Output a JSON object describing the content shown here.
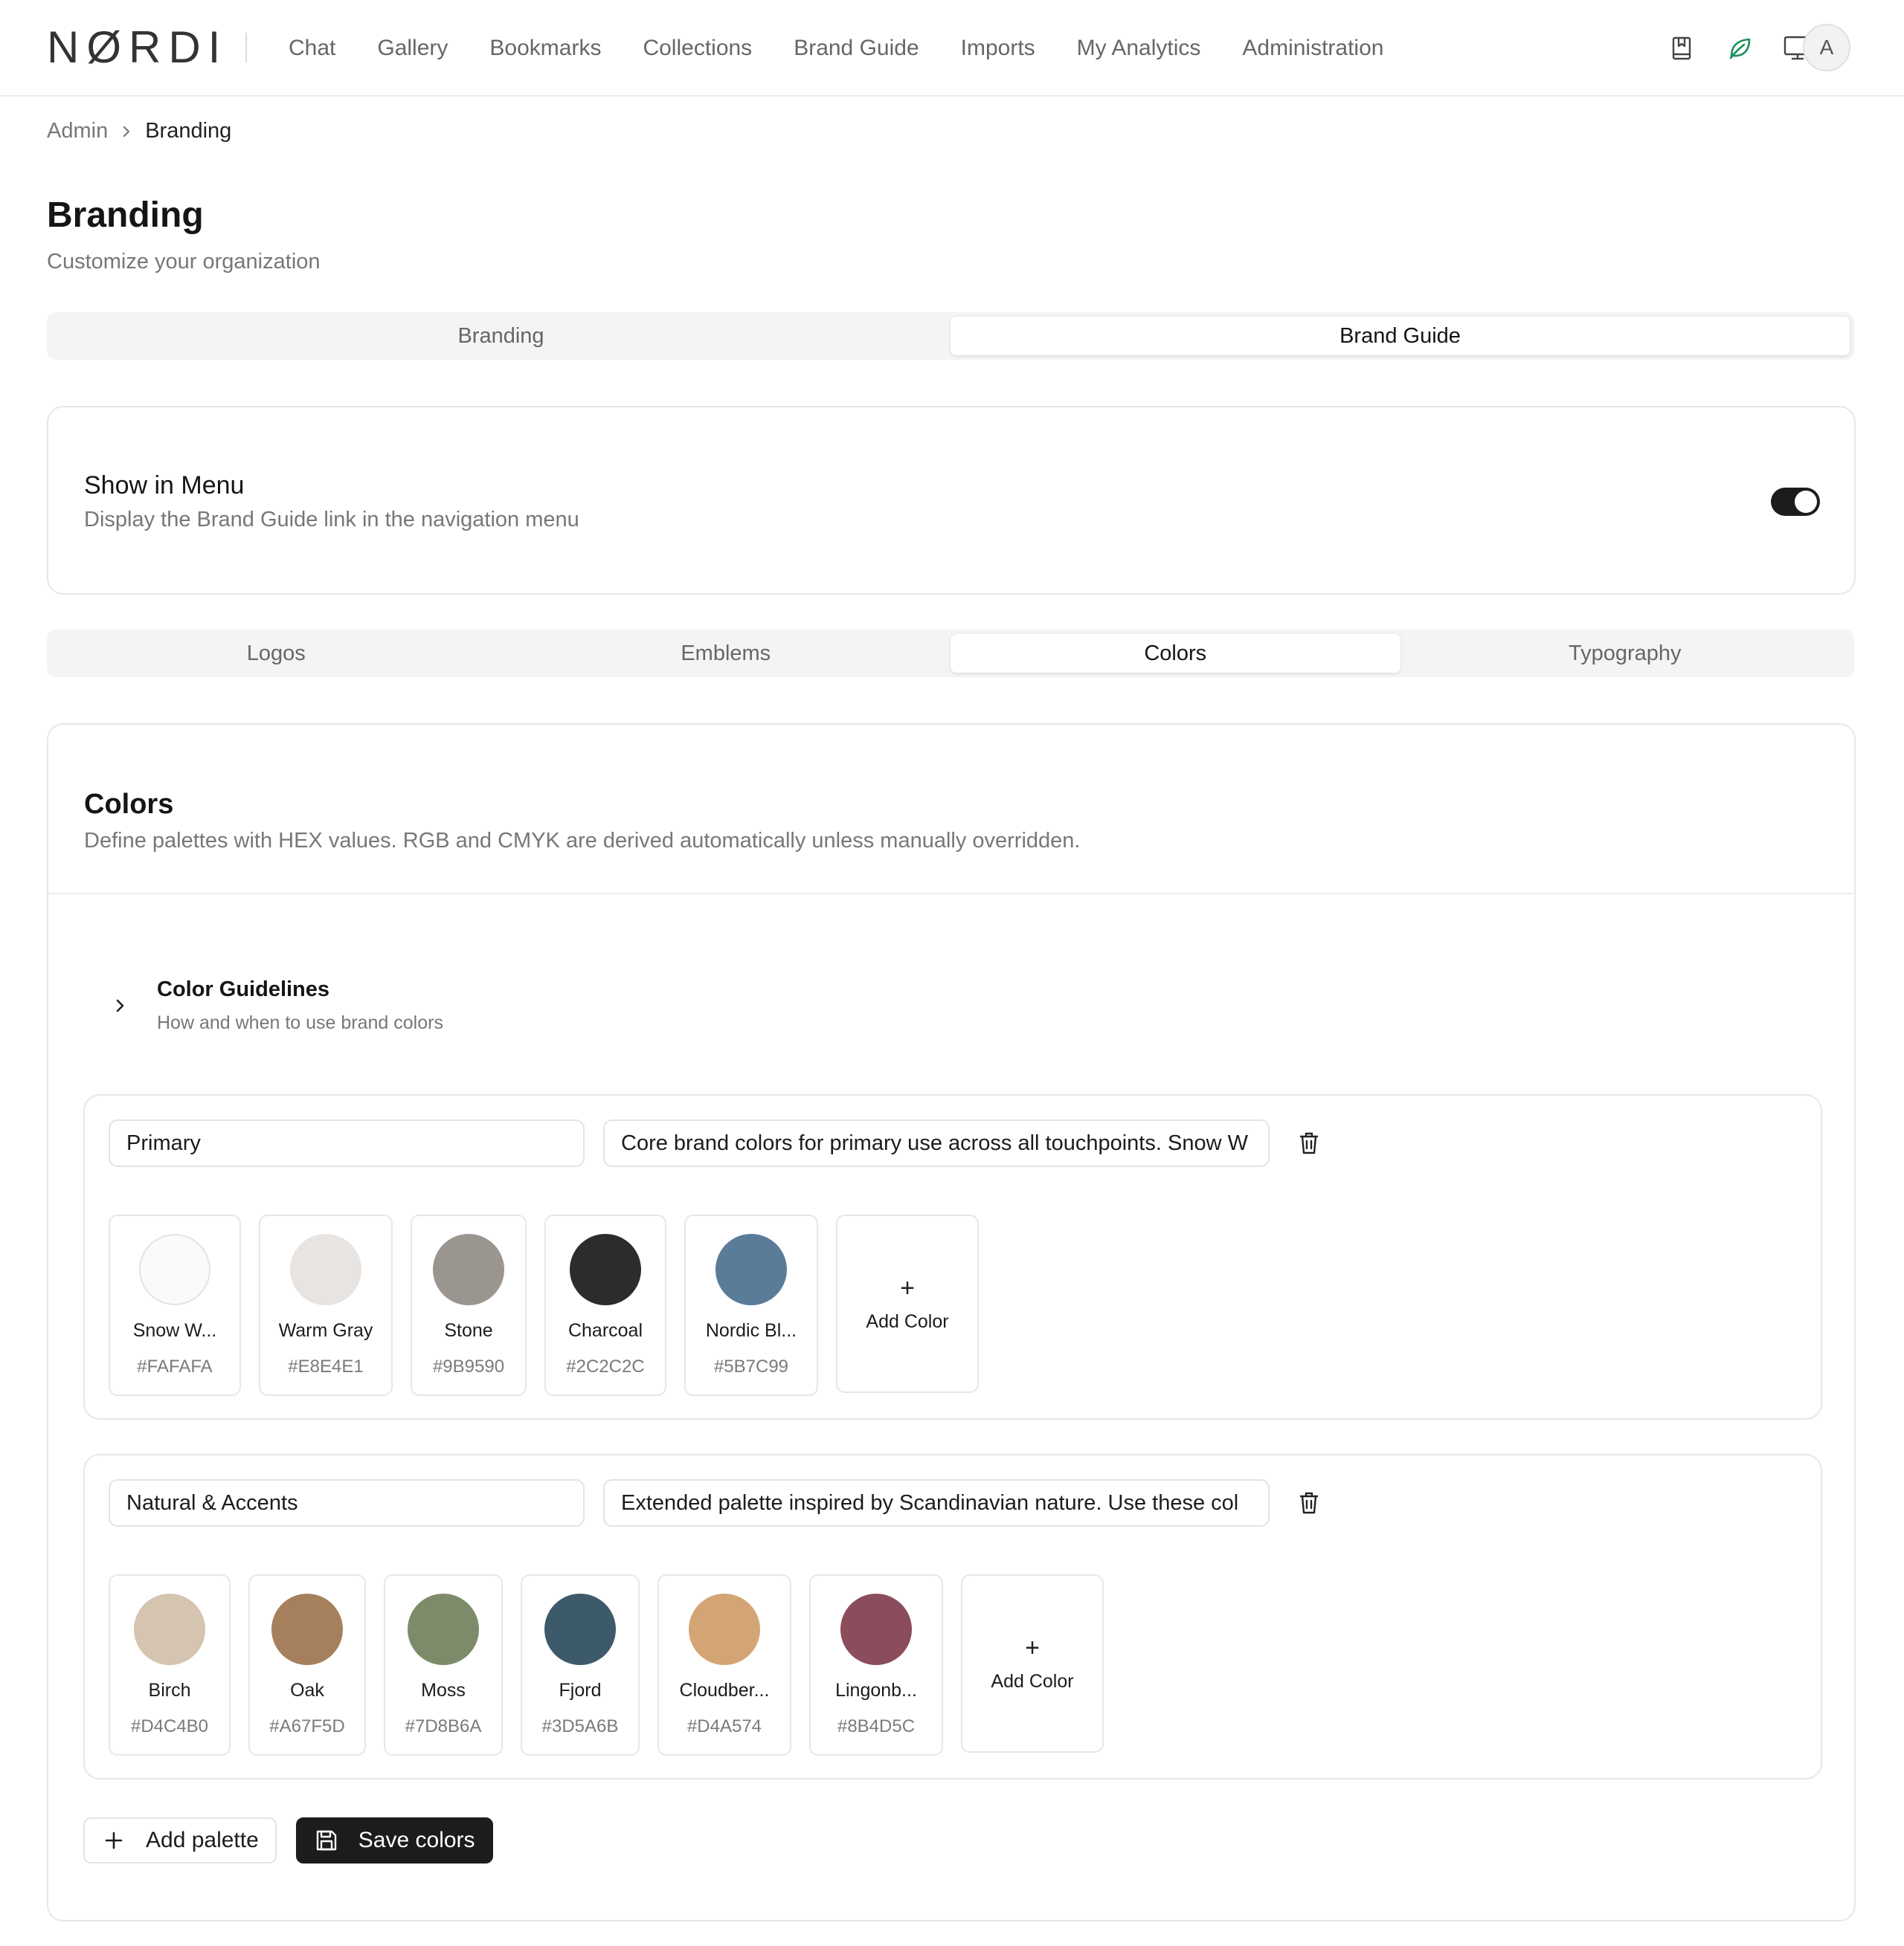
{
  "header": {
    "logo": "NØRDI",
    "nav": [
      "Chat",
      "Gallery",
      "Bookmarks",
      "Collections",
      "Brand Guide",
      "Imports",
      "My Analytics",
      "Administration"
    ],
    "avatar_initial": "A",
    "accent_color": "#1a8f5a"
  },
  "breadcrumb": {
    "parent": "Admin",
    "current": "Branding"
  },
  "page": {
    "title": "Branding",
    "subtitle": "Customize your organization"
  },
  "main_tabs": {
    "items": [
      "Branding",
      "Brand Guide"
    ],
    "active": "Brand Guide"
  },
  "menu_setting": {
    "title": "Show in Menu",
    "description": "Display the Brand Guide link in the navigation menu",
    "enabled": true
  },
  "sub_tabs": {
    "items": [
      "Logos",
      "Emblems",
      "Colors",
      "Typography"
    ],
    "active": "Colors"
  },
  "colors_section": {
    "title": "Colors",
    "description": "Define palettes with HEX values. RGB and CMYK are derived automatically unless manually overridden.",
    "guidelines": {
      "title": "Color Guidelines",
      "description": "How and when to use brand colors"
    },
    "palettes": [
      {
        "name": "Primary",
        "description": "Core brand colors for primary use across all touchpoints. Snow W",
        "colors": [
          {
            "name": "Snow W...",
            "hex": "#FAFAFA"
          },
          {
            "name": "Warm Gray",
            "hex": "#E8E4E1"
          },
          {
            "name": "Stone",
            "hex": "#9B9590"
          },
          {
            "name": "Charcoal",
            "hex": "#2C2C2C"
          },
          {
            "name": "Nordic Bl...",
            "hex": "#5B7C99"
          }
        ]
      },
      {
        "name": "Natural & Accents",
        "description": "Extended palette inspired by Scandinavian nature. Use these col",
        "colors": [
          {
            "name": "Birch",
            "hex": "#D4C4B0"
          },
          {
            "name": "Oak",
            "hex": "#A67F5D"
          },
          {
            "name": "Moss",
            "hex": "#7D8B6A"
          },
          {
            "name": "Fjord",
            "hex": "#3D5A6B"
          },
          {
            "name": "Cloudber...",
            "hex": "#D4A574"
          },
          {
            "name": "Lingonb...",
            "hex": "#8B4D5C"
          }
        ]
      }
    ],
    "add_color_plus": "+",
    "add_color_label": "Add Color",
    "add_palette_label": "Add palette",
    "save_label": "Save colors"
  }
}
